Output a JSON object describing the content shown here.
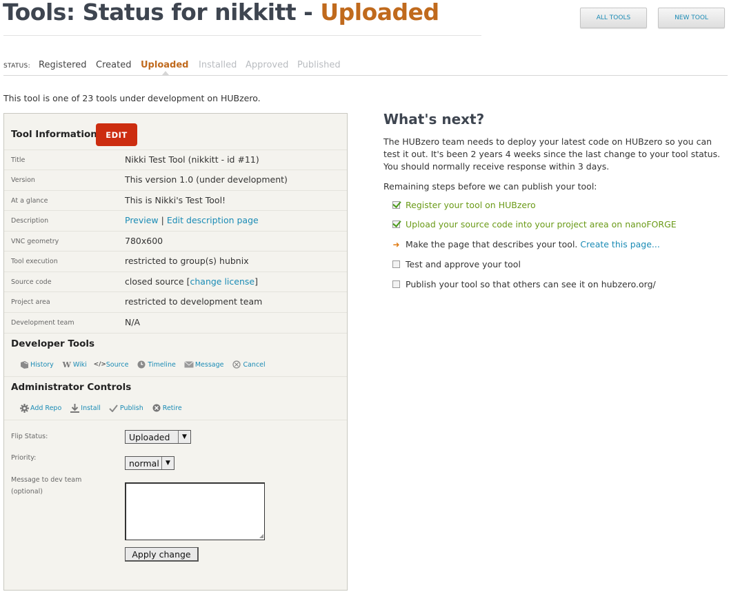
{
  "header": {
    "title_prefix": "Tools: Status for nikkitt - ",
    "title_status": "Uploaded",
    "buttons": {
      "all_tools": "All Tools",
      "new_tool": "New Tool"
    }
  },
  "status_bar": {
    "label": "STATUS:",
    "tabs": [
      {
        "label": "Registered",
        "state": "done"
      },
      {
        "label": "Created",
        "state": "done"
      },
      {
        "label": "Uploaded",
        "state": "current"
      },
      {
        "label": "Installed",
        "state": "todo"
      },
      {
        "label": "Approved",
        "state": "todo"
      },
      {
        "label": "Published",
        "state": "todo"
      }
    ]
  },
  "intro": "This tool is one of 23 tools under development on HUBzero.",
  "tool_info": {
    "heading": "Tool Information",
    "edit_label": "EDIT",
    "rows": {
      "title": {
        "label": "Title",
        "value": "Nikki Test Tool (nikkitt - id #11)"
      },
      "version": {
        "label": "Version",
        "value": "This version 1.0 (under development)"
      },
      "glance": {
        "label": "At a glance",
        "value": "This is Nikki's Test Tool!"
      },
      "description": {
        "label": "Description",
        "preview": "Preview",
        "sep": " | ",
        "edit": "Edit description page"
      },
      "vnc": {
        "label": "VNC geometry",
        "value": "780x600"
      },
      "execution": {
        "label": "Tool execution",
        "value": "restricted to group(s) hubnix"
      },
      "source": {
        "label": "Source code",
        "value": "closed source ",
        "bracket_open": "[",
        "link": "change license",
        "bracket_close": "]"
      },
      "project": {
        "label": "Project area",
        "value": "restricted to development team"
      },
      "team": {
        "label": "Development team",
        "value": "N/A"
      }
    }
  },
  "developer_tools": {
    "heading": "Developer Tools",
    "links": {
      "history": "History",
      "wiki": "Wiki",
      "source": "Source",
      "timeline": "Timeline",
      "message": "Message",
      "cancel": "Cancel"
    }
  },
  "admin": {
    "heading": "Administrator Controls",
    "links": {
      "add_repo": "Add Repo",
      "install": "Install",
      "publish": "Publish",
      "retire": "Retire"
    },
    "flip_status_label": "Flip Status:",
    "flip_status_value": "Uploaded",
    "priority_label": "Priority:",
    "priority_value": "normal",
    "message_label_1": "Message to dev team",
    "message_label_2": "(optional)",
    "message_value": "",
    "apply_label": "Apply change"
  },
  "next": {
    "heading": "What's next?",
    "description": "The HUBzero team needs to deploy your latest code on HUBzero so you can test it out. It's been 2 years 4 weeks since the last change to your tool status. You should normally receive response within 3 days.",
    "steps_heading": "Remaining steps before we can publish your tool:",
    "steps": {
      "register": "Register your tool on HUBzero",
      "upload": "Upload your source code into your project area on nanoFORGE",
      "page_text": "Make the page that describes your tool. ",
      "page_link": "Create this page...",
      "test": "Test and approve your tool",
      "publish": "Publish your tool so that others can see it on hubzero.org/"
    }
  },
  "colors": {
    "accent": "#c06a1d",
    "link": "#1a8bb5",
    "edit_button": "#cc2d10",
    "done_step": "#6a9a17"
  }
}
